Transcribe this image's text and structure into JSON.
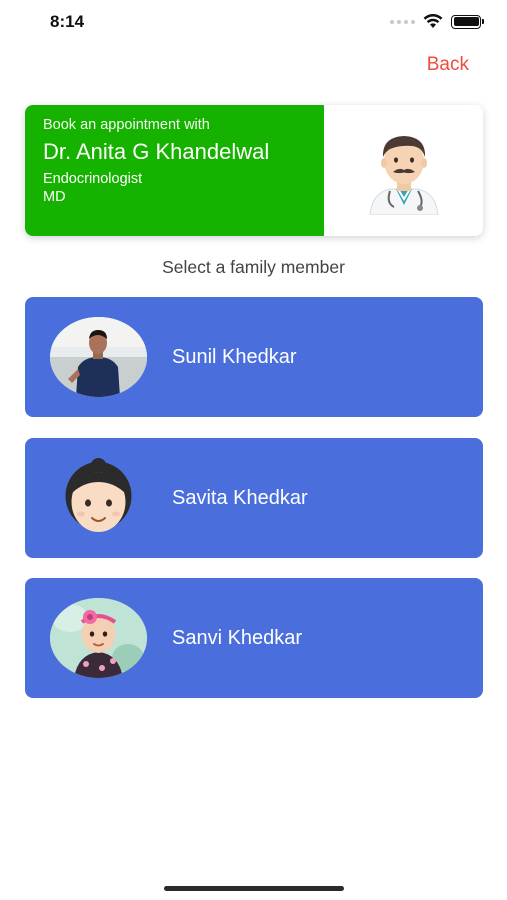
{
  "status_bar": {
    "time": "8:14"
  },
  "nav": {
    "back_label": "Back"
  },
  "doctor_card": {
    "book_label": "Book an appointment with",
    "name": "Dr. Anita G Khandelwal",
    "specialty": "Endocrinologist",
    "degree": "MD",
    "avatar_icon": "doctor-emoji-icon",
    "card_color": "#16b200"
  },
  "section_label": "Select a family member",
  "members": [
    {
      "name": "Sunil Khedkar",
      "avatar": "photo"
    },
    {
      "name": "Savita Khedkar",
      "avatar": "woman-emoji-icon"
    },
    {
      "name": "Sanvi Khedkar",
      "avatar": "photo"
    }
  ],
  "colors": {
    "member_row": "#4a6fdc",
    "back_link": "#ef4b3c"
  }
}
